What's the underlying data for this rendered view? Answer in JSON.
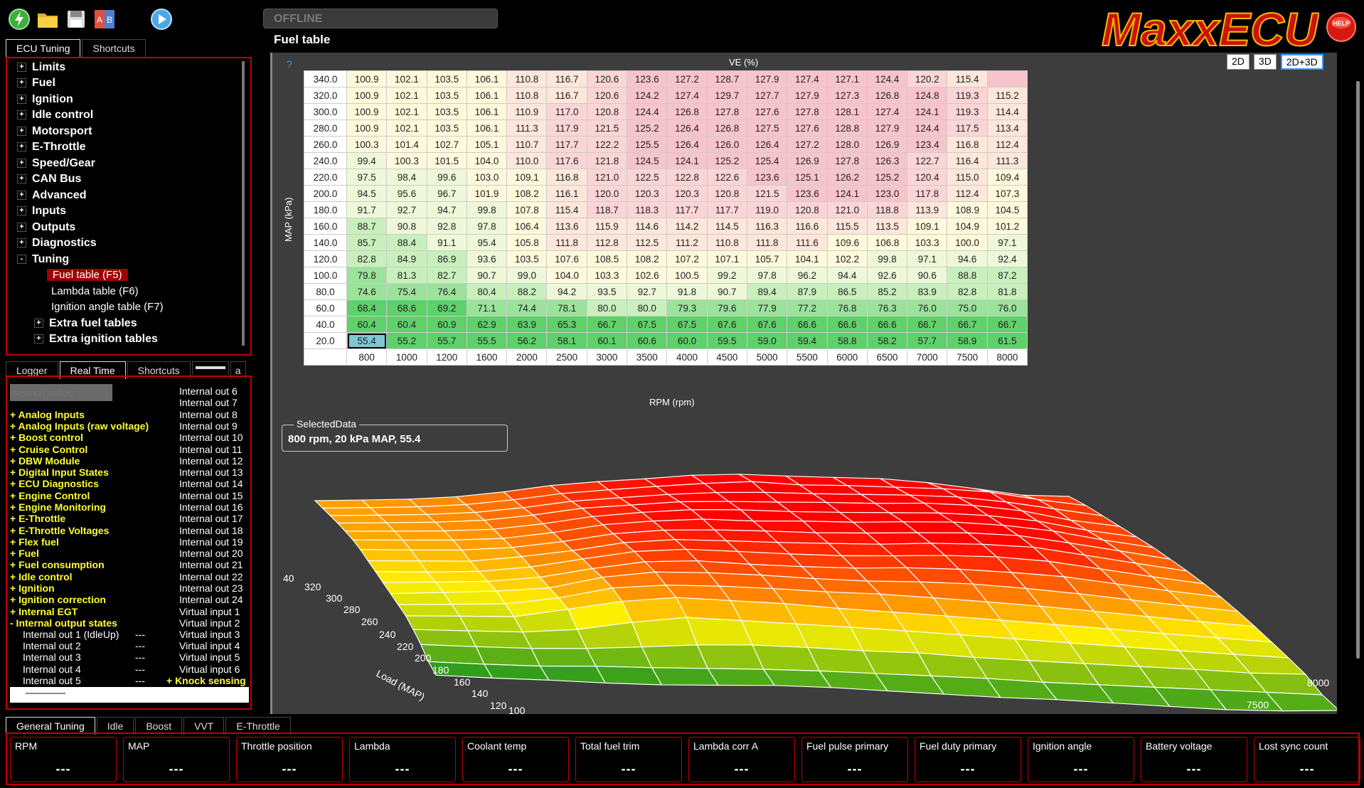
{
  "toolbar": {
    "icons": [
      "connect-icon",
      "open-folder-icon",
      "save-icon",
      "compare-icon",
      "play-icon"
    ],
    "status": "OFFLINE"
  },
  "logo": "MaxxECU",
  "help_label": "HELP",
  "page_title": "Fuel table",
  "left_tabs": [
    "ECU Tuning",
    "Shortcuts"
  ],
  "tree": {
    "items": [
      "Limits",
      "Fuel",
      "Ignition",
      "Idle control",
      "Motorsport",
      "E-Throttle",
      "Speed/Gear",
      "CAN Bus",
      "Advanced",
      "Inputs",
      "Outputs",
      "Diagnostics",
      "Tuning"
    ],
    "tuning_children": [
      "Fuel table (F5)",
      "Lambda table (F6)",
      "Ignition angle table (F7)"
    ],
    "tuning_groups": [
      "Extra fuel tables",
      "Extra ignition tables"
    ]
  },
  "rt_tabs": [
    "Logger",
    "Real Time",
    "Shortcuts",
    "a"
  ],
  "search": {
    "placeholder": "search value"
  },
  "rt_categories": [
    "+ Analog Inputs",
    "+ Analog Inputs (raw voltage)",
    "+ Boost control",
    "+ Cruise Control",
    "+ DBW Module",
    "+ Digital Input States",
    "+ ECU Diagnostics",
    "+ Engine Control",
    "+ Engine Monitoring",
    "+ E-Throttle",
    "+ E-Throttle Voltages",
    "+ Flex fuel",
    "+ Fuel",
    "+ Fuel consumption",
    "+ Idle control",
    "+ Ignition",
    "+ Ignition correction",
    "+ Internal EGT",
    "- Internal output states"
  ],
  "rt_subitems": [
    {
      "label": "Internal out 1 (IdleUp)",
      "value": "---"
    },
    {
      "label": "Internal out 2",
      "value": "---"
    },
    {
      "label": "Internal out 3",
      "value": "---"
    },
    {
      "label": "Internal out 4",
      "value": "---"
    },
    {
      "label": "Internal out 5",
      "value": "---"
    }
  ],
  "rt_right_list": [
    "Internal out 6",
    "Internal out 7",
    "Internal out 8",
    "Internal out 9",
    "Internal out 10",
    "Internal out 11",
    "Internal out 12",
    "Internal out 13",
    "Internal out 14",
    "Internal out 15",
    "Internal out 16",
    "Internal out 17",
    "Internal out 18",
    "Internal out 19",
    "Internal out 20",
    "Internal out 21",
    "Internal out 22",
    "Internal out 23",
    "Internal out 24",
    "Virtual input 1",
    "Virtual input 2",
    "Virtual input 3",
    "Virtual input 4",
    "Virtual input 5",
    "Virtual input 6"
  ],
  "rt_knock": "+ Knock sensing",
  "table": {
    "help_icon": "?",
    "title": "VE (%)",
    "view_buttons": [
      "2D",
      "3D",
      "2D+3D"
    ],
    "y_axis_label": "MAP (kPa)",
    "x_axis_label": "RPM (rpm)",
    "rpm": [
      "800",
      "1000",
      "1200",
      "1600",
      "2000",
      "2500",
      "3000",
      "3500",
      "4000",
      "4500",
      "5000",
      "5500",
      "6000",
      "6500",
      "7000",
      "7500",
      "8000"
    ],
    "map": [
      "340.0",
      "320.0",
      "300.0",
      "280.0",
      "260.0",
      "240.0",
      "220.0",
      "200.0",
      "180.0",
      "160.0",
      "140.0",
      "120.0",
      "100.0",
      "80.0",
      "60.0",
      "40.0",
      "20.0"
    ],
    "values": [
      [
        100.9,
        102.1,
        103.5,
        106.1,
        110.8,
        116.7,
        120.6,
        123.6,
        127.2,
        128.7,
        127.9,
        127.4,
        127.1,
        124.4,
        120.2,
        115.4
      ],
      [
        100.9,
        102.1,
        103.5,
        106.1,
        110.8,
        116.7,
        120.6,
        124.2,
        127.4,
        129.7,
        127.7,
        127.9,
        127.3,
        126.8,
        124.8,
        119.3,
        115.2
      ],
      [
        100.9,
        102.1,
        103.5,
        106.1,
        110.9,
        117.0,
        120.8,
        124.4,
        126.8,
        127.8,
        127.6,
        127.8,
        128.1,
        127.4,
        124.1,
        119.3,
        114.4
      ],
      [
        100.9,
        102.1,
        103.5,
        106.1,
        111.3,
        117.9,
        121.5,
        125.2,
        126.4,
        126.8,
        127.5,
        127.6,
        128.8,
        127.9,
        124.4,
        117.5,
        113.4
      ],
      [
        100.3,
        101.4,
        102.7,
        105.1,
        110.7,
        117.7,
        122.2,
        125.5,
        126.4,
        126.0,
        126.4,
        127.2,
        128.0,
        126.9,
        123.4,
        116.8,
        112.4
      ],
      [
        99.4,
        100.3,
        101.5,
        104.0,
        110.0,
        117.6,
        121.8,
        124.5,
        124.1,
        125.2,
        125.4,
        126.9,
        127.8,
        126.3,
        122.7,
        116.4,
        111.3
      ],
      [
        97.5,
        98.4,
        99.6,
        103.0,
        109.1,
        116.8,
        121.0,
        122.5,
        122.8,
        122.6,
        123.6,
        125.1,
        126.2,
        125.2,
        120.4,
        115.0,
        109.4
      ],
      [
        94.5,
        95.6,
        96.7,
        101.9,
        108.2,
        116.1,
        120.0,
        120.3,
        120.3,
        120.8,
        121.5,
        123.6,
        124.1,
        123.0,
        117.8,
        112.4,
        107.3
      ],
      [
        91.7,
        92.7,
        94.7,
        99.8,
        107.8,
        115.4,
        118.7,
        118.3,
        117.7,
        117.7,
        119.0,
        120.8,
        121.0,
        118.8,
        113.9,
        108.9,
        104.5
      ],
      [
        88.7,
        90.8,
        92.8,
        97.8,
        106.4,
        113.6,
        115.9,
        114.6,
        114.2,
        114.5,
        116.3,
        116.6,
        115.5,
        113.5,
        109.1,
        104.9,
        101.2
      ],
      [
        85.7,
        88.4,
        91.1,
        95.4,
        105.8,
        111.8,
        112.8,
        112.5,
        111.2,
        110.8,
        111.8,
        111.6,
        109.6,
        106.8,
        103.3,
        100.0,
        97.1
      ],
      [
        82.8,
        84.9,
        86.9,
        93.6,
        103.5,
        107.6,
        108.5,
        108.2,
        107.2,
        107.1,
        105.7,
        104.1,
        102.2,
        99.8,
        97.1,
        94.6,
        92.4
      ],
      [
        79.8,
        81.3,
        82.7,
        90.7,
        99.0,
        104.0,
        103.3,
        102.6,
        100.5,
        99.2,
        97.8,
        96.2,
        94.4,
        92.6,
        90.6,
        88.8,
        87.2
      ],
      [
        74.6,
        75.4,
        76.4,
        80.4,
        88.2,
        94.2,
        93.5,
        92.7,
        91.8,
        90.7,
        89.4,
        87.9,
        86.5,
        85.2,
        83.9,
        82.8,
        81.8
      ],
      [
        68.4,
        68.6,
        69.2,
        71.1,
        74.4,
        78.1,
        80.0,
        80.0,
        79.3,
        79.6,
        77.9,
        77.2,
        76.8,
        76.3,
        76.0,
        75.0,
        76.0
      ],
      [
        60.4,
        60.4,
        60.9,
        62.9,
        63.9,
        65.3,
        66.7,
        67.5,
        67.5,
        67.6,
        67.6,
        66.6,
        66.6,
        66.6,
        66.7,
        66.7,
        66.7
      ],
      [
        55.4,
        55.2,
        55.7,
        55.5,
        56.2,
        58.1,
        60.1,
        60.6,
        60.0,
        59.5,
        59.0,
        59.4,
        58.8,
        58.2,
        57.7,
        58.9,
        61.5
      ]
    ],
    "selected": {
      "row": 16,
      "col": 0
    }
  },
  "selected_data": {
    "title": "SelectedData",
    "value": "800 rpm, 20 kPa MAP, 55.4"
  },
  "surface": {
    "load_label": "Load (MAP)",
    "load_ticks": [
      "40",
      "320",
      "300",
      "280",
      "260",
      "240",
      "220",
      "200",
      "180",
      "160",
      "140",
      "120",
      "100"
    ],
    "rpm_ticks": [
      "8000",
      "7500"
    ]
  },
  "bottom_tabs": [
    "General Tuning",
    "Idle",
    "Boost",
    "VVT",
    "E-Throttle"
  ],
  "gauges": [
    {
      "label": "RPM",
      "value": "---"
    },
    {
      "label": "MAP",
      "value": "---"
    },
    {
      "label": "Throttle position",
      "value": "---"
    },
    {
      "label": "Lambda",
      "value": "---"
    },
    {
      "label": "Coolant temp",
      "value": "---"
    },
    {
      "label": "Total fuel trim",
      "value": "---"
    },
    {
      "label": "Lambda corr A",
      "value": "---"
    },
    {
      "label": "Fuel pulse primary",
      "value": "---"
    },
    {
      "label": "Fuel duty primary",
      "value": "---"
    },
    {
      "label": "Ignition angle",
      "value": "---"
    },
    {
      "label": "Battery voltage",
      "value": "---"
    },
    {
      "label": "Lost sync count",
      "value": "---"
    }
  ],
  "colors": {
    "accent_red": "#c00000",
    "panel_bg": "#3d3d3d",
    "label_yellow": "#ffff33",
    "selected_cell": "#7dc8d3"
  }
}
